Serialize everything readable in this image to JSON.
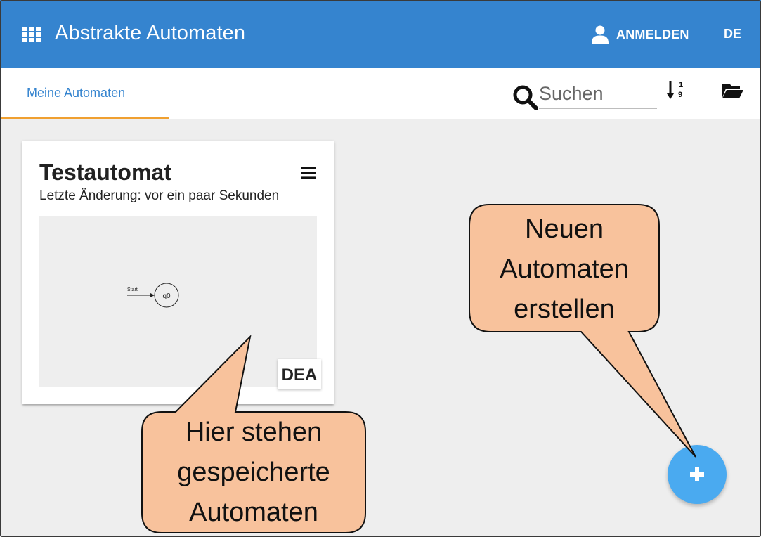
{
  "app": {
    "title": "Abstrakte Automaten",
    "login_label": "ANMELDEN",
    "language": "DE",
    "apps_icon": "apps-grid-icon",
    "user_icon": "user-icon"
  },
  "toolbar": {
    "tab_label": "Meine Automaten",
    "search_placeholder": "Suchen",
    "search_value": "",
    "sort_icon": "sort-numeric-icon",
    "open_icon": "folder-open-icon"
  },
  "card": {
    "title": "Testautomat",
    "subtitle": "Letzte Änderung: vor ein paar Sekunden",
    "type_badge": "DEA",
    "preview": {
      "start_label": "Start",
      "state_label": "q0"
    }
  },
  "fab": {
    "label": "+"
  },
  "callouts": {
    "new_automaton": [
      "Neuen",
      "Automaten",
      "erstellen"
    ],
    "saved_automata": [
      "Hier stehen",
      "gespeicherte",
      "Automaten"
    ]
  },
  "colors": {
    "appbar": "#3584cf",
    "tab_text": "#3584cf",
    "tab_indicator": "#f0a030",
    "fab": "#4aaaf0",
    "callout_fill": "#f8c29c",
    "background": "#eeeeee"
  }
}
